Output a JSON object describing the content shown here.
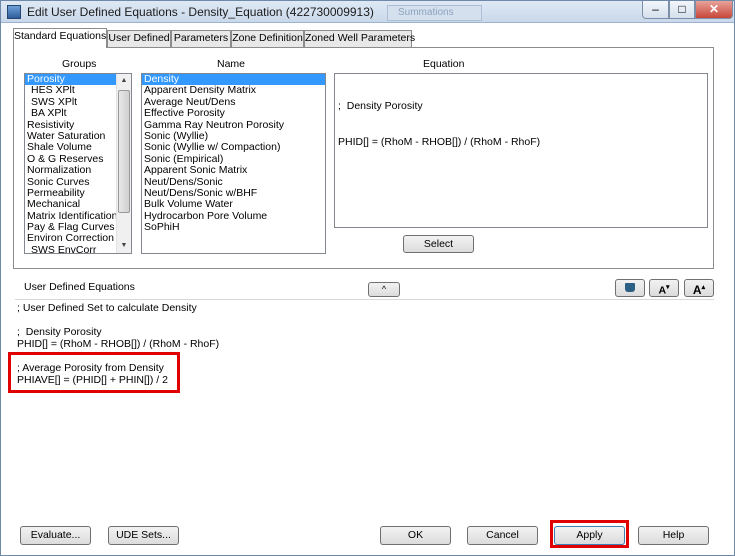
{
  "window": {
    "title": "Edit User Defined Equations - Density_Equation (422730009913)",
    "background_tab": "Summations",
    "controls": {
      "minimize": "–",
      "maximize": "□",
      "close": "✕"
    }
  },
  "tabs": [
    "Standard Equations",
    "User Defined",
    "Parameters",
    "Zone Definition",
    "Zoned Well Parameters"
  ],
  "active_tab": "Standard Equations",
  "groups": {
    "header": "Groups",
    "items": [
      {
        "label": "Porosity",
        "selected": true,
        "indent": false
      },
      {
        "label": "HES XPlt",
        "selected": false,
        "indent": true
      },
      {
        "label": "SWS XPlt",
        "selected": false,
        "indent": true
      },
      {
        "label": "BA XPlt",
        "selected": false,
        "indent": true
      },
      {
        "label": "Resistivity",
        "selected": false,
        "indent": false
      },
      {
        "label": "Water Saturation",
        "selected": false,
        "indent": false
      },
      {
        "label": "Shale Volume",
        "selected": false,
        "indent": false
      },
      {
        "label": "O & G Reserves",
        "selected": false,
        "indent": false
      },
      {
        "label": "Normalization",
        "selected": false,
        "indent": false
      },
      {
        "label": "Sonic Curves",
        "selected": false,
        "indent": false
      },
      {
        "label": "Permeability",
        "selected": false,
        "indent": false
      },
      {
        "label": "Mechanical",
        "selected": false,
        "indent": false
      },
      {
        "label": "Matrix Identification",
        "selected": false,
        "indent": false
      },
      {
        "label": "Pay & Flag Curves",
        "selected": false,
        "indent": false
      },
      {
        "label": "Environ Correction",
        "selected": false,
        "indent": false
      },
      {
        "label": "SWS EnvCorr",
        "selected": false,
        "indent": true
      }
    ]
  },
  "names": {
    "header": "Name",
    "items": [
      {
        "label": "Density",
        "selected": true
      },
      {
        "label": "Apparent Density Matrix",
        "selected": false
      },
      {
        "label": "Average Neut/Dens",
        "selected": false
      },
      {
        "label": "Effective Porosity",
        "selected": false
      },
      {
        "label": "Gamma Ray Neutron Porosity",
        "selected": false
      },
      {
        "label": "Sonic (Wyllie)",
        "selected": false
      },
      {
        "label": "Sonic (Wyllie w/ Compaction)",
        "selected": false
      },
      {
        "label": "Sonic (Empirical)",
        "selected": false
      },
      {
        "label": "Apparent Sonic Matrix",
        "selected": false
      },
      {
        "label": "Neut/Dens/Sonic",
        "selected": false
      },
      {
        "label": "Neut/Dens/Sonic w/BHF",
        "selected": false
      },
      {
        "label": "Bulk Volume Water",
        "selected": false
      },
      {
        "label": "Hydrocarbon Pore Volume",
        "selected": false
      },
      {
        "label": "SoPhiH",
        "selected": false
      }
    ]
  },
  "equation": {
    "header": "Equation",
    "lines": [
      ";  Density Porosity",
      "PHID[] = (RhoM - RHOB[]) / (RhoM - RhoF)"
    ],
    "select_label": "Select"
  },
  "ude": {
    "label": "User Defined Equations",
    "collapse_label": "^",
    "tool_buttons": [
      "A",
      "A",
      "A"
    ],
    "lines": [
      "; User Defined Set to calculate Density",
      "",
      ";  Density Porosity",
      "PHID[] = (RhoM - RHOB[]) / (RhoM - RhoF)",
      "",
      "; Average Porosity from Density",
      "PHIAVE[] = (PHID[] + PHIN[]) / 2"
    ]
  },
  "footer": {
    "evaluate": "Evaluate...",
    "ude_sets": "UDE Sets...",
    "ok": "OK",
    "cancel": "Cancel",
    "apply": "Apply",
    "help": "Help"
  },
  "colors": {
    "highlight": "#e00000",
    "selection": "#3399ff"
  }
}
